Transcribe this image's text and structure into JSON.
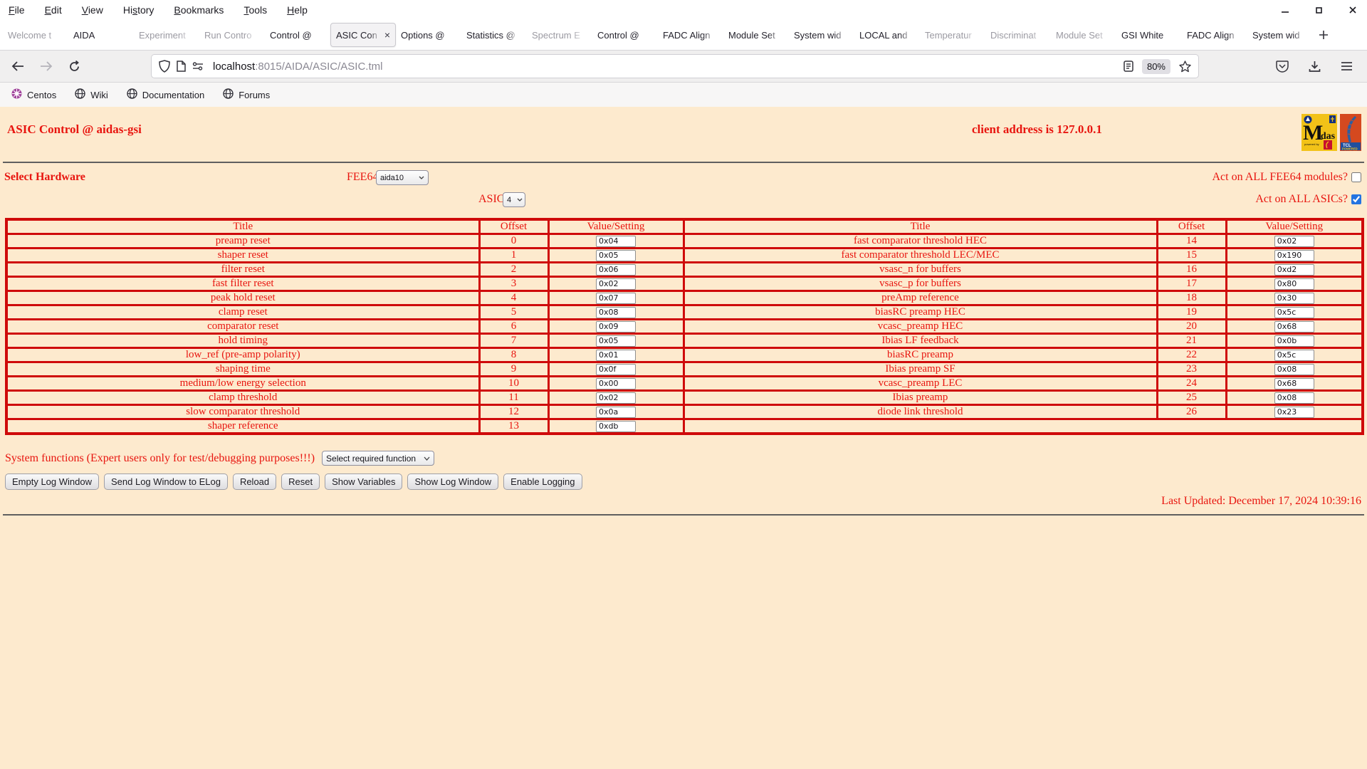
{
  "menu": {
    "items": [
      {
        "label": "File",
        "u": 0
      },
      {
        "label": "Edit",
        "u": 0
      },
      {
        "label": "View",
        "u": 0
      },
      {
        "label": "History",
        "u": 2
      },
      {
        "label": "Bookmarks",
        "u": 0
      },
      {
        "label": "Tools",
        "u": 0
      },
      {
        "label": "Help",
        "u": 0
      }
    ],
    "window_controls": [
      "minimize",
      "maximize",
      "close"
    ]
  },
  "tabs": {
    "items": [
      {
        "label": "Welcome t",
        "dim": true
      },
      {
        "label": "AIDA",
        "dim": false
      },
      {
        "label": "Experiment",
        "dim": true
      },
      {
        "label": "Run Contro",
        "dim": true
      },
      {
        "label": "Control @",
        "dim": false
      },
      {
        "label": "ASIC Con",
        "active": true,
        "dim": false
      },
      {
        "label": "Options @",
        "dim": false
      },
      {
        "label": "Statistics @",
        "dim": false
      },
      {
        "label": "Spectrum E",
        "dim": true
      },
      {
        "label": "Control @",
        "dim": false
      },
      {
        "label": "FADC Align",
        "dim": false
      },
      {
        "label": "Module Set",
        "dim": false
      },
      {
        "label": "System wid",
        "dim": false
      },
      {
        "label": "LOCAL and",
        "dim": false
      },
      {
        "label": "Temperatur",
        "dim": true
      },
      {
        "label": "Discriminat",
        "dim": true
      },
      {
        "label": "Module Set",
        "dim": true
      },
      {
        "label": "GSI White",
        "dim": false
      },
      {
        "label": "FADC Align",
        "dim": false
      },
      {
        "label": "System wid",
        "dim": false
      }
    ]
  },
  "nav": {
    "url_host": "localhost",
    "url_rest": ":8015/AIDA/ASIC/ASIC.tml",
    "zoom": "80%"
  },
  "bookmarks": [
    {
      "label": "Centos",
      "icon": "centos-logo"
    },
    {
      "label": "Wiki",
      "icon": "globe"
    },
    {
      "label": "Documentation",
      "icon": "globe"
    },
    {
      "label": "Forums",
      "icon": "globe"
    }
  ],
  "page": {
    "title": "ASIC Control @ aidas-gsi",
    "client_address": "client address is 127.0.0.1",
    "select_hardware_label": "Select Hardware",
    "fee64_label": "FEE64",
    "fee64_value": "aida10",
    "asic_label": "ASIC",
    "asic_value": "4",
    "act_all_fee64_label": "Act on ALL FEE64 modules?",
    "act_all_fee64_checked": false,
    "act_all_asics_label": "Act on ALL ASICs?",
    "act_all_asics_checked": true,
    "system_functions_label": "System functions (Expert users only for test/debugging purposes!!!)",
    "system_functions_value": "Select required function",
    "buttons": [
      "Empty Log Window",
      "Send Log Window to ELog",
      "Reload",
      "Reset",
      "Show Variables",
      "Show Log Window",
      "Enable Logging"
    ],
    "last_updated": "Last Updated: December 17, 2024 10:39:16",
    "logos": {
      "midas": "Midas",
      "tcl": "TCL POWERED"
    }
  },
  "asic_table": {
    "headers": [
      "Title",
      "Offset",
      "Value/Setting"
    ],
    "left_rows": [
      {
        "title": "preamp reset",
        "offset": "0",
        "value": "0x04"
      },
      {
        "title": "shaper reset",
        "offset": "1",
        "value": "0x05"
      },
      {
        "title": "filter reset",
        "offset": "2",
        "value": "0x06"
      },
      {
        "title": "fast filter reset",
        "offset": "3",
        "value": "0x02"
      },
      {
        "title": "peak hold reset",
        "offset": "4",
        "value": "0x07"
      },
      {
        "title": "clamp reset",
        "offset": "5",
        "value": "0x08"
      },
      {
        "title": "comparator reset",
        "offset": "6",
        "value": "0x09"
      },
      {
        "title": "hold timing",
        "offset": "7",
        "value": "0x05"
      },
      {
        "title": "low_ref (pre-amp polarity)",
        "offset": "8",
        "value": "0x01"
      },
      {
        "title": "shaping time",
        "offset": "9",
        "value": "0x0f"
      },
      {
        "title": "medium/low energy selection",
        "offset": "10",
        "value": "0x00"
      },
      {
        "title": "clamp threshold",
        "offset": "11",
        "value": "0x02"
      },
      {
        "title": "slow comparator threshold",
        "offset": "12",
        "value": "0x0a"
      },
      {
        "title": "shaper reference",
        "offset": "13",
        "value": "0xdb"
      }
    ],
    "right_rows": [
      {
        "title": "fast comparator threshold HEC",
        "offset": "14",
        "value": "0x02"
      },
      {
        "title": "fast comparator threshold LEC/MEC",
        "offset": "15",
        "value": "0x190"
      },
      {
        "title": "vsasc_n for buffers",
        "offset": "16",
        "value": "0xd2"
      },
      {
        "title": "vsasc_p for buffers",
        "offset": "17",
        "value": "0x80"
      },
      {
        "title": "preAmp reference",
        "offset": "18",
        "value": "0x30"
      },
      {
        "title": "biasRC preamp HEC",
        "offset": "19",
        "value": "0x5c"
      },
      {
        "title": "vcasc_preamp HEC",
        "offset": "20",
        "value": "0x68"
      },
      {
        "title": "Ibias LF feedback",
        "offset": "21",
        "value": "0x0b"
      },
      {
        "title": "biasRC preamp",
        "offset": "22",
        "value": "0x5c"
      },
      {
        "title": "Ibias preamp SF",
        "offset": "23",
        "value": "0x08"
      },
      {
        "title": "vcasc_preamp LEC",
        "offset": "24",
        "value": "0x68"
      },
      {
        "title": "Ibias preamp",
        "offset": "25",
        "value": "0x08"
      },
      {
        "title": "diode link threshold",
        "offset": "26",
        "value": "0x23"
      }
    ]
  },
  "colors": {
    "page_bg": "#fdeace",
    "red_text": "#e8150f",
    "red_border": "#cf0a0a",
    "checkbox_accent": "#2374e1",
    "chrome_bar": "#f0efef"
  }
}
